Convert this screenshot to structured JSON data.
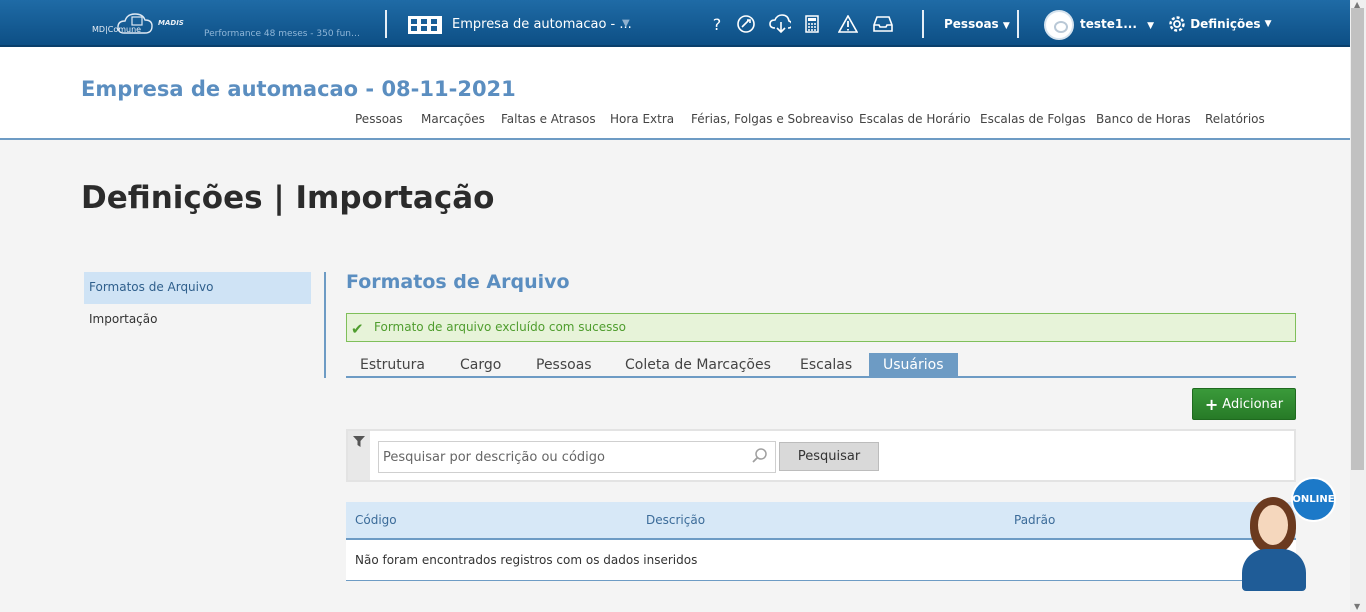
{
  "topbar": {
    "logo": {
      "md_text": "MD|Comune",
      "madis_text": "MADIS"
    },
    "performance": "Performance 48 meses - 350 funcion...",
    "company": "Empresa de automacao - ...",
    "icons": [
      "help-icon",
      "rocket-icon",
      "cloud-download-icon",
      "calculator-icon",
      "warning-icon",
      "inbox-icon"
    ],
    "help_text": "?",
    "pessoas": "Pessoas",
    "user": "teste1...",
    "definicoes": "Definições"
  },
  "header": {
    "company_title": "Empresa de automacao - 08-11-2021",
    "nav": [
      "Pessoas",
      "Marcações",
      "Faltas e Atrasos",
      "Hora Extra",
      "Férias, Folgas e Sobreaviso",
      "Escalas de Horário",
      "Escalas de Folgas",
      "Banco de Horas",
      "Relatórios"
    ]
  },
  "page_title": "Definições | Importação",
  "sidebar": {
    "items": [
      "Formatos de Arquivo",
      "Importação"
    ],
    "active": 0
  },
  "content": {
    "title": "Formatos de Arquivo",
    "alert": "Formato de arquivo excluído com sucesso",
    "tabs": [
      "Estrutura",
      "Cargo",
      "Pessoas",
      "Coleta de Marcações",
      "Escalas",
      "Usuários"
    ],
    "active_tab": 5,
    "add_button": "Adicionar",
    "search": {
      "placeholder": "Pesquisar por descrição ou código",
      "value": "",
      "button": "Pesquisar"
    },
    "table": {
      "columns": [
        "Código",
        "Descrição",
        "Padrão"
      ],
      "empty_message": "Não foram encontrados registros com os dados inseridos"
    }
  },
  "chat": {
    "badge": "ONLINE"
  },
  "colors": {
    "topbar": "#1f6ba6",
    "accent": "#5b8ec0",
    "success": "#4f9d2e",
    "add_button": "#3a9a3a"
  }
}
